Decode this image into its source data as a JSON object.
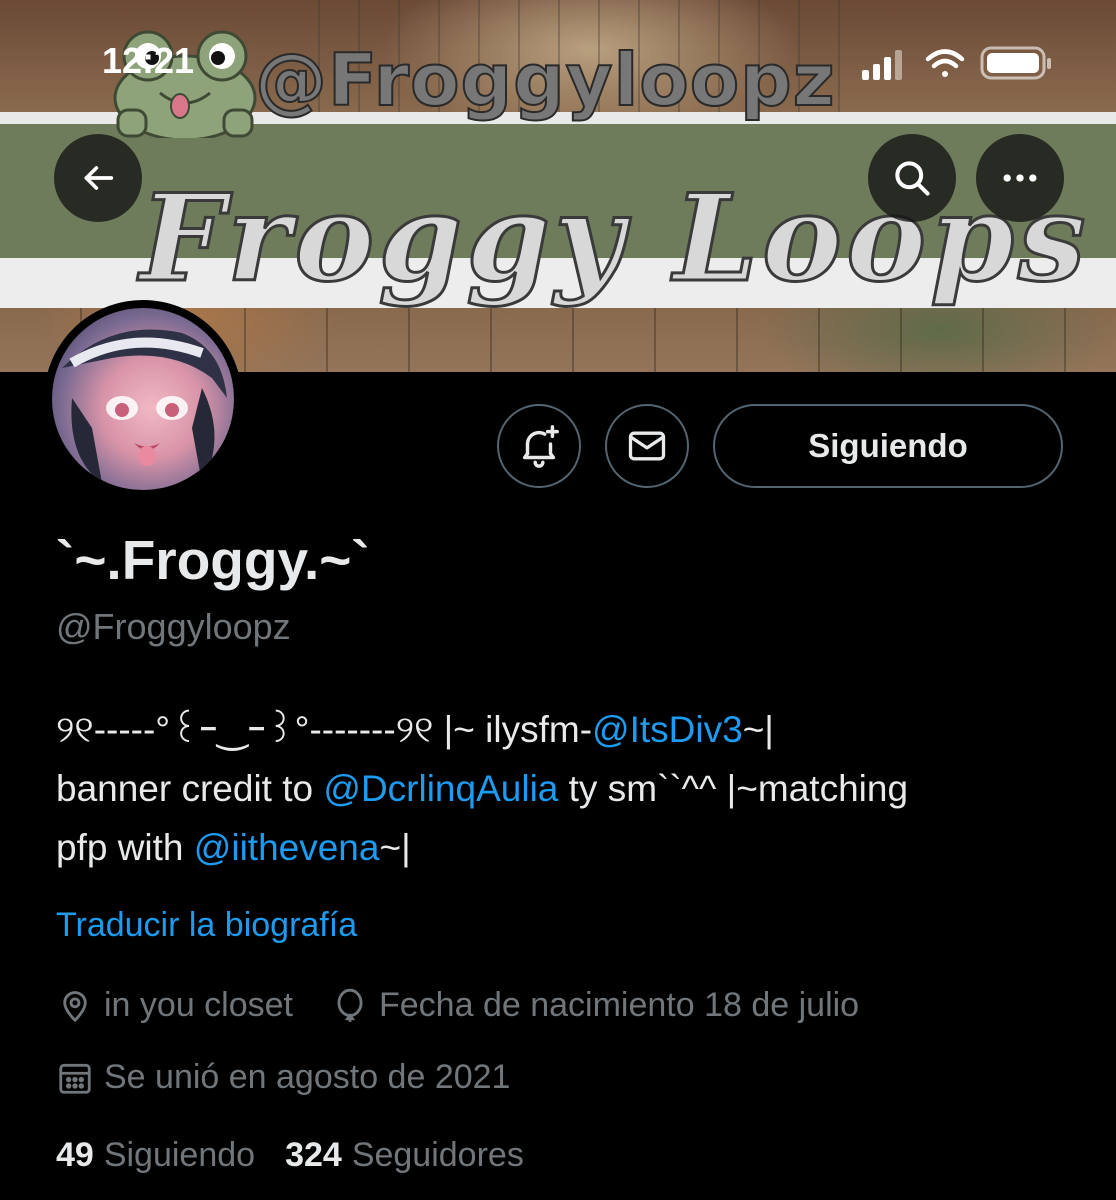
{
  "status_bar": {
    "time": "12:21"
  },
  "banner": {
    "handle_text": "@Froggyloopz",
    "title_text": "Froggy Loops"
  },
  "profile": {
    "display_name": "`~.Froggy.~`",
    "handle": "@Froggyloopz",
    "bio": {
      "line1_prefix": "୨୧-----°꒰ｰ‿ｰ꒱°-------୨୧ |~ ilysfm-",
      "mention1": "@ItsDiv3",
      "line1_suffix": "~|",
      "line2_prefix": "banner credit to ",
      "mention2": "@DcrlinqAulia",
      "line2_suffix": " ty sm``^^ |~matching",
      "line3_prefix": "pfp with ",
      "mention3": "@iithevena",
      "line3_suffix": "~|"
    },
    "translate_link": "Traducir la biografía",
    "location": "in you closet",
    "birthday": "Fecha de nacimiento 18 de julio",
    "joined": "Se unió en agosto de 2021",
    "following_count": "49",
    "following_label": "Siguiendo",
    "followers_count": "324",
    "followers_label": "Seguidores"
  },
  "actions": {
    "follow_button_label": "Siguiendo"
  },
  "colors": {
    "background": "#000000",
    "text_primary": "#e7e9ea",
    "text_secondary": "#71767b",
    "link": "#1d9bf0",
    "border": "#536471"
  },
  "icons": {
    "back": "arrow-left-icon",
    "search": "search-icon",
    "more": "more-horizontal-icon",
    "notify": "bell-plus-icon",
    "message": "mail-icon",
    "location": "location-pin-icon",
    "birthday": "balloon-icon",
    "joined": "calendar-icon"
  }
}
